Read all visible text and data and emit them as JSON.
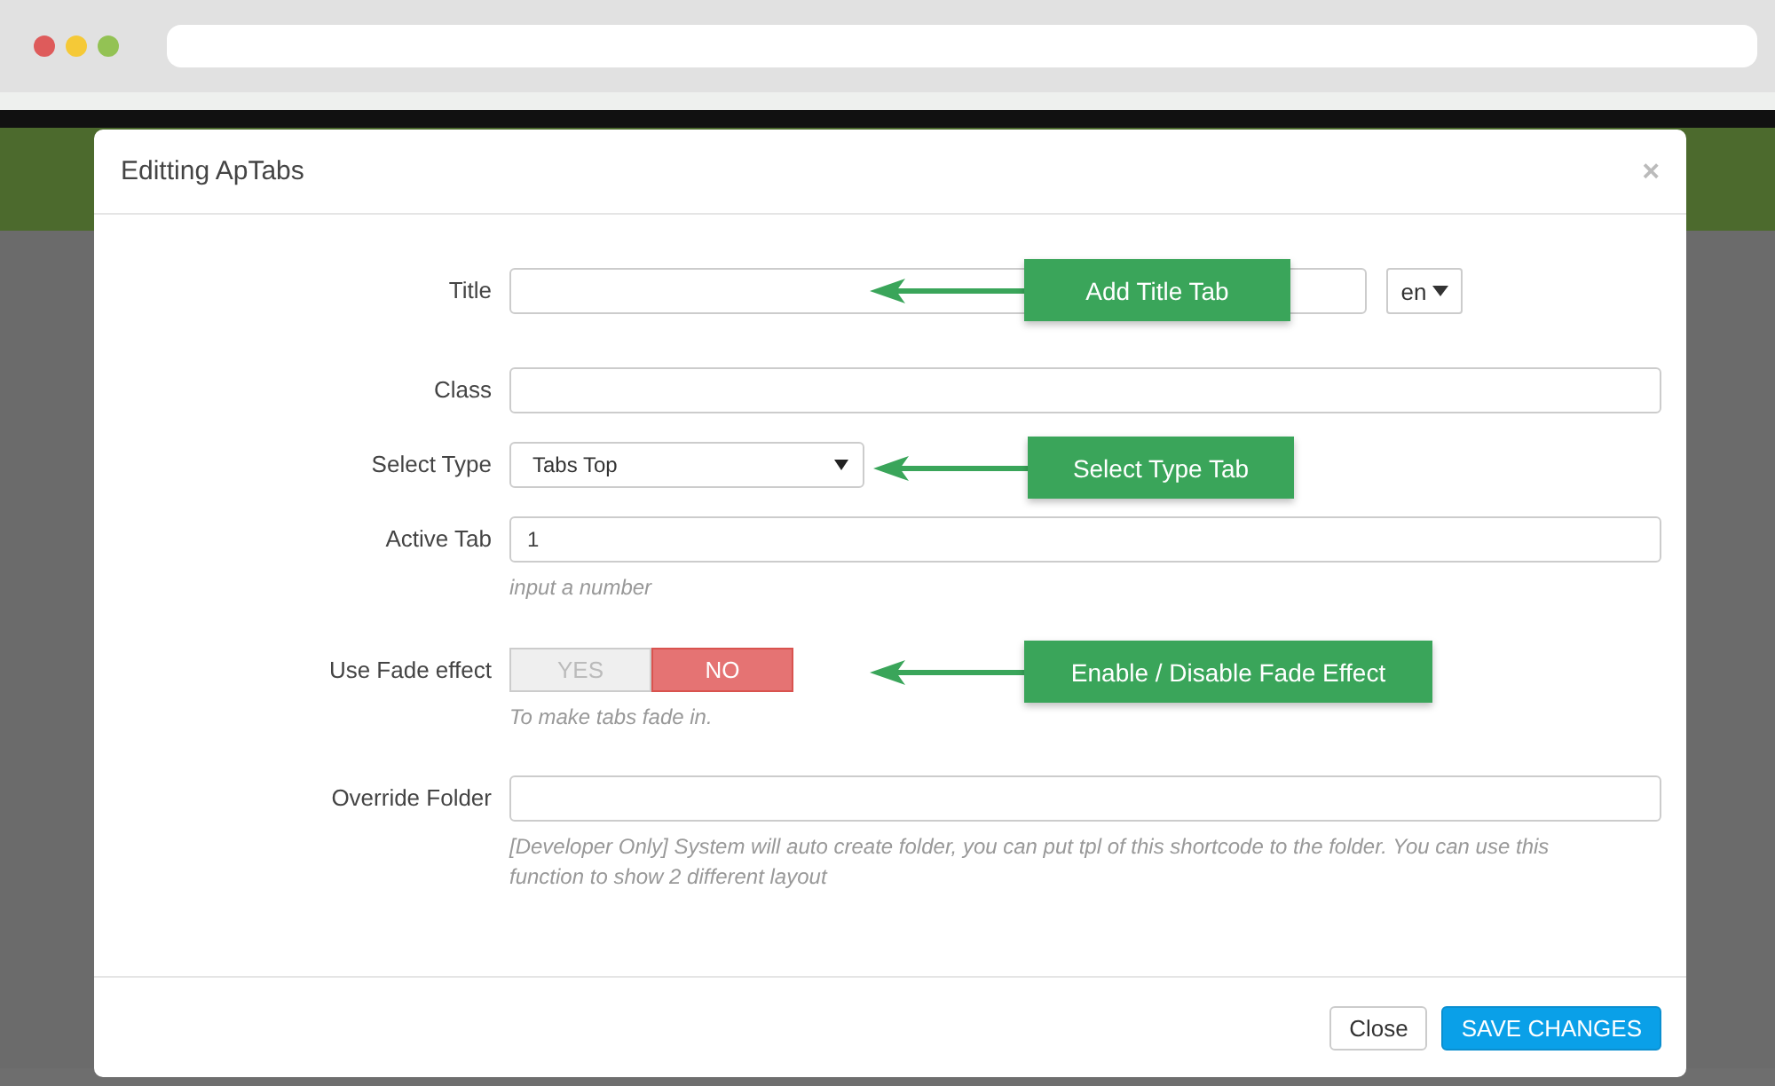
{
  "modal": {
    "title": "Editting ApTabs",
    "close": "×"
  },
  "fields": [
    {
      "kind": "text",
      "label": "Title",
      "lang": "en"
    },
    {
      "kind": "text",
      "label": "Class"
    },
    {
      "kind": "select",
      "label": "Select Type",
      "value": "Tabs Top"
    },
    {
      "kind": "text",
      "label": "Active Tab",
      "value": "1",
      "hint": "input a number"
    },
    {
      "kind": "toggle",
      "label": "Use Fade effect",
      "options": [
        {
          "label": "YES",
          "selected": false
        },
        {
          "label": "NO",
          "selected": true
        }
      ],
      "hint": "To make tabs fade in."
    },
    {
      "kind": "text",
      "label": "Override Folder",
      "hint": "[Developer Only] System will auto create folder, you can put tpl of this shortcode to the folder. You can use this function to show 2 different layout"
    }
  ],
  "annotations": [
    {
      "text": "Add Title Tab"
    },
    {
      "text": "Select Type Tab"
    },
    {
      "text": "Enable / Disable Fade Effect"
    }
  ],
  "buttons": [
    {
      "label": "Close",
      "kind": "default"
    },
    {
      "label": "SAVE CHANGES",
      "kind": "primary"
    }
  ]
}
